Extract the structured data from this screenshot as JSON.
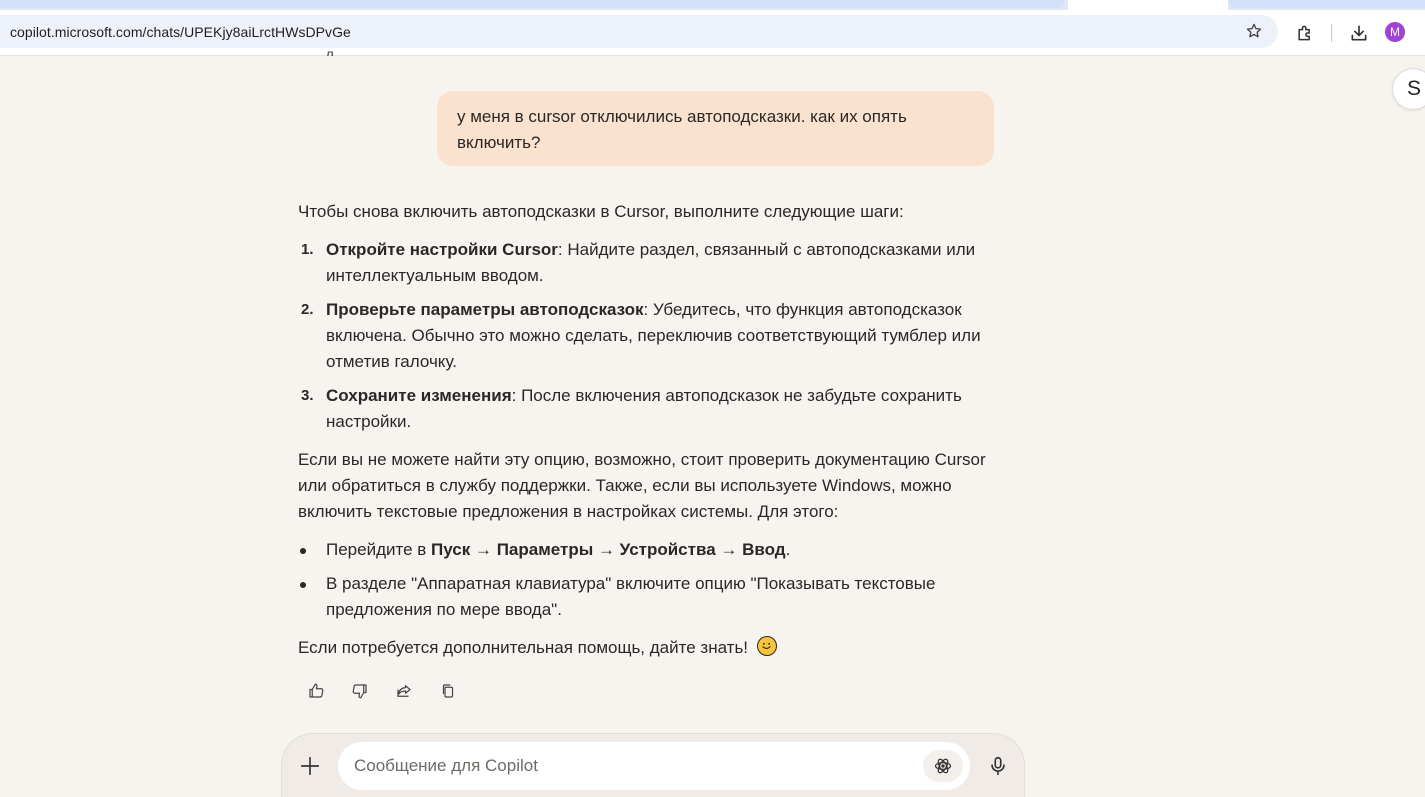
{
  "browser": {
    "url": "copilot.microsoft.com/chats/UPEKjy8aiLrctHWsDPvGe",
    "profile_initial": "M",
    "profile_color": "#a142d4",
    "icons": [
      "star-icon",
      "extensions-icon",
      "download-icon"
    ]
  },
  "sidebar": {
    "avatar_initial": "S"
  },
  "chat": {
    "user_message": "у меня в cursor отключились автоподсказки. как их опять включить?",
    "answer": {
      "intro": "Чтобы снова включить автоподсказки в Cursor, выполните следующие шаги:",
      "steps": [
        {
          "num": "1.",
          "title": "Откройте настройки Cursor",
          "text": ": Найдите раздел, связанный с автоподсказками или интеллектуальным вводом."
        },
        {
          "num": "2.",
          "title": "Проверьте параметры автоподсказок",
          "text": ": Убедитесь, что функция автоподсказок включена. Обычно это можно сделать, переключив соответствующий тумблер или отметив галочку."
        },
        {
          "num": "3.",
          "title": "Сохраните изменения",
          "text": ": После включения автоподсказок не забудьте сохранить настройки."
        }
      ],
      "middle": "Если вы не можете найти эту опцию, возможно, стоит проверить документацию Cursor или обратиться в службу поддержки. Также, если вы используете Windows, можно включить текстовые предложения в настройках системы. Для этого:",
      "bullets": {
        "first_prefix": "Перейдите в ",
        "first_bold": "Пуск → Параметры → Устройства → Ввод",
        "first_suffix": ".",
        "second": "В разделе \"Аппаратная клавиатура\" включите опцию \"Показывать текстовые предложения по мере ввода\"."
      },
      "closing": "Если потребуется дополнительная помощь, дайте знать!",
      "closing_emoji": "smiling-face-emoji"
    },
    "actions": [
      "like-icon",
      "dislike-icon",
      "share-icon",
      "copy-icon"
    ]
  },
  "composer": {
    "placeholder": "Сообщение для Copilot",
    "value": "",
    "icons": [
      "plus-icon",
      "think-deeper-icon",
      "microphone-icon"
    ]
  },
  "colors": {
    "page_bg": "#f7f3ef",
    "user_bubble": "#fbe2cf",
    "composer_bg": "#f0ebe6",
    "omnibox": "#edf2fa"
  }
}
